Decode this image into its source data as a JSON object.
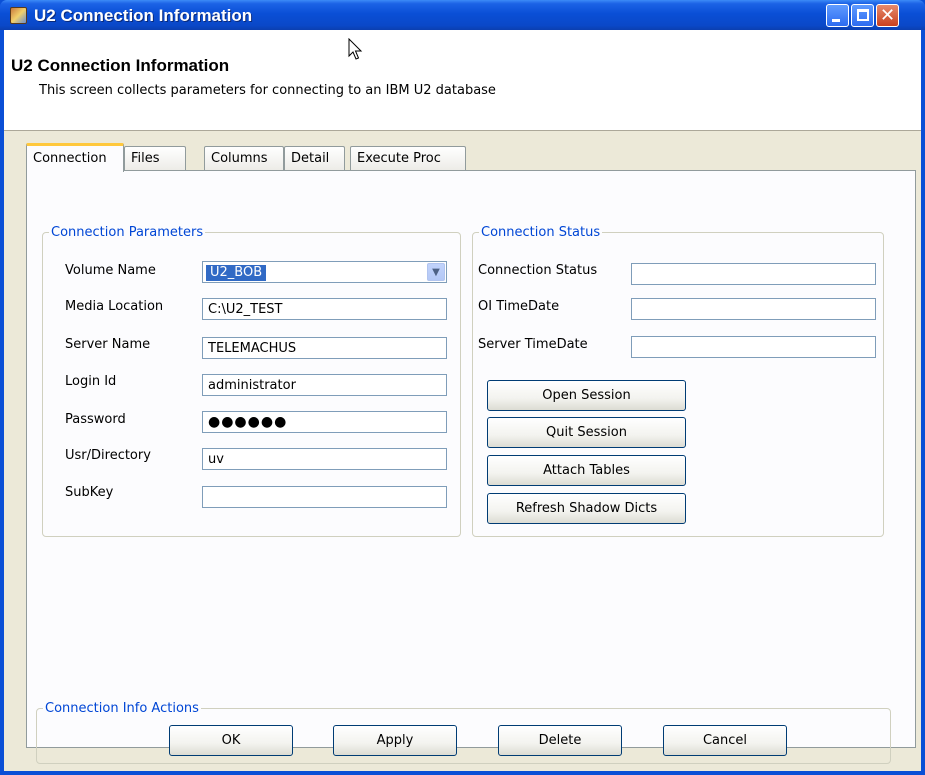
{
  "window": {
    "title": "U2 Connection Information"
  },
  "header": {
    "title": "U2 Connection Information",
    "description": "This screen collects parameters for connecting to an IBM U2 database"
  },
  "tabs": [
    {
      "label": "Connection",
      "active": true
    },
    {
      "label": "Files",
      "active": false
    },
    {
      "label": "Columns",
      "active": false
    },
    {
      "label": "Detail",
      "active": false
    },
    {
      "label": "Execute Proc",
      "active": false
    }
  ],
  "connection_parameters": {
    "legend": "Connection Parameters",
    "volume_name": {
      "label": "Volume Name",
      "value": "U2_BOB"
    },
    "media_location": {
      "label": "Media Location",
      "value": "C:\\U2_TEST"
    },
    "server_name": {
      "label": "Server Name",
      "value": "TELEMACHUS"
    },
    "login_id": {
      "label": "Login Id",
      "value": "administrator"
    },
    "password": {
      "label": "Password",
      "value": "●●●●●●"
    },
    "usr_directory": {
      "label": "Usr/Directory",
      "value": "uv"
    },
    "subkey": {
      "label": "SubKey",
      "value": ""
    }
  },
  "connection_status": {
    "legend": "Connection Status",
    "connection_status": {
      "label": "Connection Status",
      "value": ""
    },
    "oi_timedate": {
      "label": "OI TimeDate",
      "value": ""
    },
    "server_timedate": {
      "label": "Server TimeDate",
      "value": ""
    },
    "buttons": {
      "open_session": "Open Session",
      "quit_session": "Quit Session",
      "attach_tables": "Attach Tables",
      "refresh_shadow_dicts": "Refresh Shadow Dicts"
    }
  },
  "actions": {
    "legend": "Connection Info Actions",
    "ok": "OK",
    "apply": "Apply",
    "delete": "Delete",
    "cancel": "Cancel"
  },
  "icons": {
    "app": "database-app-icon",
    "minimize": "minimize-icon",
    "maximize": "maximize-icon",
    "close": "close-icon",
    "combo": "chevron-down-icon",
    "cursor": "mouse-pointer-icon"
  },
  "colors": {
    "titlebar": "#0a4fd6",
    "group_legend": "#0046d5",
    "selection": "#316ac5",
    "active_tab_accent": "#ffc83c"
  }
}
